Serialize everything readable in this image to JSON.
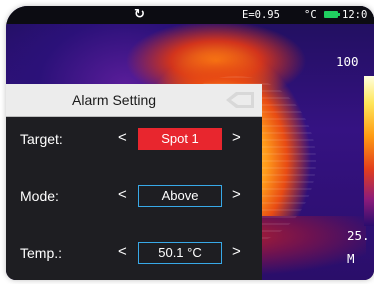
{
  "status_bar": {
    "refresh_icon": "refresh-icon",
    "emissivity": "E=0.95",
    "unit": "°C",
    "battery_icon": "battery-icon",
    "battery_color": "#20d060",
    "time": "12:0"
  },
  "scale": {
    "max_label": "100",
    "min_label": "25.",
    "min_suffix": "M"
  },
  "dialog": {
    "title": "Alarm Setting",
    "back_icon": "back-arrow-icon",
    "rows": [
      {
        "label": "Target:",
        "value": "Spot 1",
        "selected": true
      },
      {
        "label": "Mode:",
        "value": "Above",
        "selected": false
      },
      {
        "label": "Temp.:",
        "value": "50.1 °C",
        "selected": false
      }
    ],
    "left_arrow": "<",
    "right_arrow": ">"
  },
  "colors": {
    "accent_selected": "#e8262e",
    "value_border": "#38a9e8",
    "panel_bg": "#1e1e22",
    "header_bg": "#ececec"
  }
}
